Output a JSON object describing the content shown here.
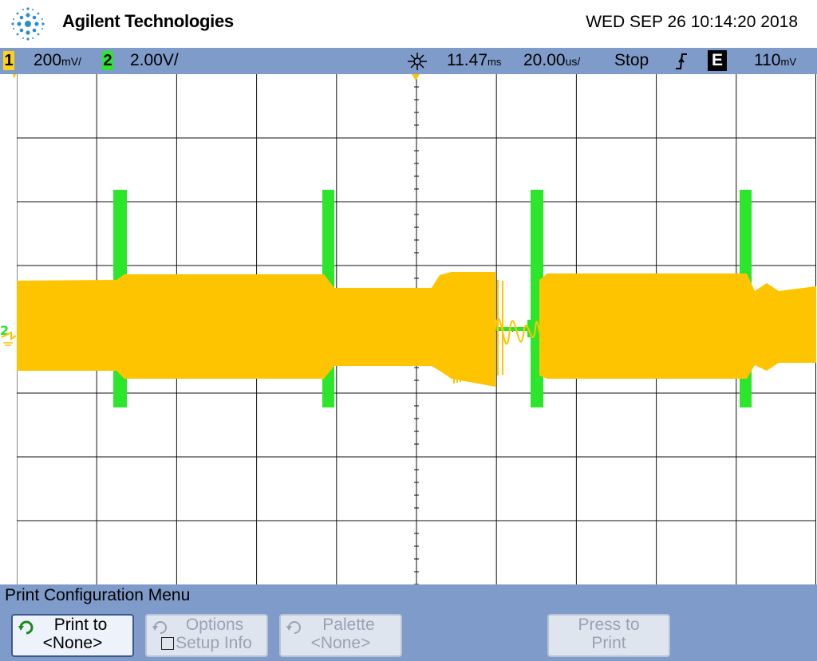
{
  "header": {
    "brand": "Agilent Technologies",
    "datetime": "WED SEP 26 10:14:20 2018",
    "logo_icon": "agilent-spark-icon"
  },
  "status": {
    "ch1_num": "1",
    "ch1_scale": "200",
    "ch1_unit": "mV/",
    "ch2_num": "2",
    "ch2_scale": "2.00V/",
    "trigger_icon": "trigger-position-icon",
    "delay": "11.47",
    "delay_unit": "ms",
    "timebase": "20.00",
    "timebase_unit": "us/",
    "run_state": "Stop",
    "slope_icon": "rising-edge-icon",
    "trigger_source": "E",
    "trigger_level": "110",
    "trigger_level_unit": "mV"
  },
  "colors": {
    "ch1": "#ffc400",
    "ch2": "#2ce62c",
    "status_bar": "#7f9bc9",
    "grid": "#111111"
  },
  "markers": {
    "ground_label": "2"
  },
  "menu": {
    "title": "Print Configuration Menu",
    "softkeys": [
      {
        "line1": "Print to",
        "line2": "<None>",
        "icon": "rotate-knob-icon",
        "enabled": true
      },
      {
        "line1": "Options",
        "line2": "Setup Info",
        "icon": "rotate-knob-icon",
        "enabled": false
      },
      {
        "line1": "Palette",
        "line2": "<None>",
        "icon": "rotate-knob-icon",
        "enabled": false
      },
      {
        "line1": "Press to",
        "line2": "Print",
        "icon": "",
        "enabled": false
      }
    ]
  }
}
